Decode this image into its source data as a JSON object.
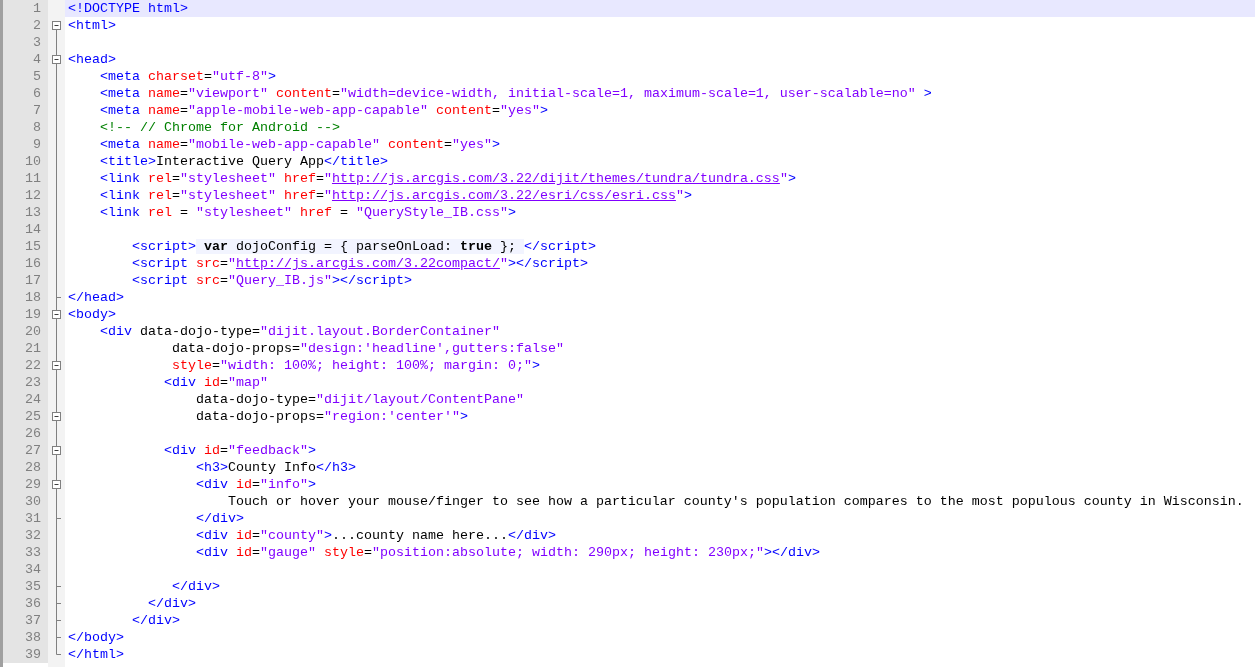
{
  "editor": {
    "lines": [
      {
        "number": "1",
        "current": true,
        "fold_start": false,
        "fold_end": false,
        "tokens": [
          {
            "kind": "tag",
            "text": "<!DOCTYPE html>"
          }
        ]
      },
      {
        "number": "2",
        "current": false,
        "fold_start": true,
        "fold_end": false,
        "tokens": [
          {
            "kind": "tag",
            "text": "<html>"
          }
        ]
      },
      {
        "number": "3",
        "current": false,
        "fold_start": false,
        "fold_end": false
      },
      {
        "number": "4",
        "current": false,
        "fold_start": true,
        "fold_end": false,
        "tokens": [
          {
            "kind": "tag",
            "text": "<head>"
          }
        ]
      },
      {
        "number": "5",
        "current": false,
        "fold_start": false,
        "fold_end": false,
        "tokens": [
          {
            "kind": "tag",
            "text": "    <meta "
          },
          {
            "kind": "attr",
            "text": "charset"
          },
          {
            "kind": "plain",
            "text": "="
          },
          {
            "kind": "value",
            "text": "\"utf-8\""
          },
          {
            "kind": "tag",
            "text": ">"
          }
        ]
      },
      {
        "number": "6",
        "current": false,
        "fold_start": false,
        "fold_end": false,
        "tokens": [
          {
            "kind": "tag",
            "text": "    <meta "
          },
          {
            "kind": "attr",
            "text": "name"
          },
          {
            "kind": "plain",
            "text": "="
          },
          {
            "kind": "value",
            "text": "\"viewport\" "
          },
          {
            "kind": "attr",
            "text": "content"
          },
          {
            "kind": "plain",
            "text": "="
          },
          {
            "kind": "value",
            "text": "\"width=device-width, initial-scale=1, maximum-scale=1, user-scalable=no\" "
          },
          {
            "kind": "tag",
            "text": ">"
          }
        ]
      },
      {
        "number": "7",
        "current": false,
        "fold_start": false,
        "fold_end": false,
        "tokens": [
          {
            "kind": "tag",
            "text": "    <meta "
          },
          {
            "kind": "attr",
            "text": "name"
          },
          {
            "kind": "plain",
            "text": "="
          },
          {
            "kind": "value",
            "text": "\"apple-mobile-web-app-capable\" "
          },
          {
            "kind": "attr",
            "text": "content"
          },
          {
            "kind": "plain",
            "text": "="
          },
          {
            "kind": "value",
            "text": "\"yes\""
          },
          {
            "kind": "tag",
            "text": ">"
          }
        ]
      },
      {
        "number": "8",
        "current": false,
        "fold_start": false,
        "fold_end": false,
        "tokens": [
          {
            "kind": "comment",
            "text": "    <!-- // Chrome for Android -->"
          }
        ]
      },
      {
        "number": "9",
        "current": false,
        "fold_start": false,
        "fold_end": false,
        "tokens": [
          {
            "kind": "tag",
            "text": "    <meta "
          },
          {
            "kind": "attr",
            "text": "name"
          },
          {
            "kind": "plain",
            "text": "="
          },
          {
            "kind": "value",
            "text": "\"mobile-web-app-capable\" "
          },
          {
            "kind": "attr",
            "text": "content"
          },
          {
            "kind": "plain",
            "text": "="
          },
          {
            "kind": "value",
            "text": "\"yes\""
          },
          {
            "kind": "tag",
            "text": ">"
          }
        ]
      },
      {
        "number": "10",
        "current": false,
        "fold_start": false,
        "fold_end": false,
        "tokens": [
          {
            "kind": "tag",
            "text": "    <title>"
          },
          {
            "kind": "text",
            "text": "Interactive Query App"
          },
          {
            "kind": "tag",
            "text": "</title>"
          }
        ]
      },
      {
        "number": "11",
        "current": false,
        "fold_start": false,
        "fold_end": false,
        "tokens": [
          {
            "kind": "tag",
            "text": "    <link "
          },
          {
            "kind": "attr",
            "text": "rel"
          },
          {
            "kind": "plain",
            "text": "="
          },
          {
            "kind": "value",
            "text": "\"stylesheet\" "
          },
          {
            "kind": "attr",
            "text": "href"
          },
          {
            "kind": "plain",
            "text": "="
          },
          {
            "kind": "value",
            "text": "\""
          },
          {
            "kind": "link",
            "text": "http://js.arcgis.com/3.22/dijit/themes/tundra/tundra.css"
          },
          {
            "kind": "value",
            "text": "\""
          },
          {
            "kind": "tag",
            "text": ">"
          }
        ]
      },
      {
        "number": "12",
        "current": false,
        "fold_start": false,
        "fold_end": false,
        "tokens": [
          {
            "kind": "tag",
            "text": "    <link "
          },
          {
            "kind": "attr",
            "text": "rel"
          },
          {
            "kind": "plain",
            "text": "="
          },
          {
            "kind": "value",
            "text": "\"stylesheet\" "
          },
          {
            "kind": "attr",
            "text": "href"
          },
          {
            "kind": "plain",
            "text": "="
          },
          {
            "kind": "value",
            "text": "\""
          },
          {
            "kind": "link",
            "text": "http://js.arcgis.com/3.22/esri/css/esri.css"
          },
          {
            "kind": "value",
            "text": "\""
          },
          {
            "kind": "tag",
            "text": ">"
          }
        ]
      },
      {
        "number": "13",
        "current": false,
        "fold_start": false,
        "fold_end": false,
        "tokens": [
          {
            "kind": "tag",
            "text": "    <link "
          },
          {
            "kind": "attr",
            "text": "rel"
          },
          {
            "kind": "plain",
            "text": " = "
          },
          {
            "kind": "value",
            "text": "\"stylesheet\" "
          },
          {
            "kind": "attr",
            "text": "href"
          },
          {
            "kind": "plain",
            "text": " = "
          },
          {
            "kind": "value",
            "text": "\"QueryStyle_IB.css\""
          },
          {
            "kind": "tag",
            "text": ">"
          }
        ]
      },
      {
        "number": "14",
        "current": false,
        "fold_start": false,
        "fold_end": false
      },
      {
        "number": "15",
        "current": false,
        "fold_start": false,
        "fold_end": false,
        "tokens": [
          {
            "kind": "tag",
            "text": "        <script>"
          },
          {
            "kind": "keyword",
            "text": " var"
          },
          {
            "kind": "script",
            "text": " dojoConfig = { parseOnLoad: "
          },
          {
            "kind": "keyword",
            "text": "true"
          },
          {
            "kind": "script",
            "text": " }; "
          },
          {
            "kind": "tag",
            "text": "</script>"
          }
        ]
      },
      {
        "number": "16",
        "current": false,
        "fold_start": false,
        "fold_end": false,
        "tokens": [
          {
            "kind": "tag",
            "text": "        <script "
          },
          {
            "kind": "attr",
            "text": "src"
          },
          {
            "kind": "plain",
            "text": "="
          },
          {
            "kind": "value",
            "text": "\""
          },
          {
            "kind": "link",
            "text": "http://js.arcgis.com/3.22compact/"
          },
          {
            "kind": "value",
            "text": "\""
          },
          {
            "kind": "tag",
            "text": "></script>"
          }
        ]
      },
      {
        "number": "17",
        "current": false,
        "fold_start": false,
        "fold_end": false,
        "tokens": [
          {
            "kind": "tag",
            "text": "        <script "
          },
          {
            "kind": "attr",
            "text": "src"
          },
          {
            "kind": "plain",
            "text": "="
          },
          {
            "kind": "value",
            "text": "\"Query_IB.js\""
          },
          {
            "kind": "tag",
            "text": "></script>"
          }
        ]
      },
      {
        "number": "18",
        "current": false,
        "fold_start": false,
        "fold_end": true,
        "tokens": [
          {
            "kind": "tag",
            "text": "</head>"
          }
        ]
      },
      {
        "number": "19",
        "current": false,
        "fold_start": true,
        "fold_end": false,
        "tokens": [
          {
            "kind": "tag",
            "text": "<body>"
          }
        ]
      },
      {
        "number": "20",
        "current": false,
        "fold_start": false,
        "fold_end": false,
        "tokens": [
          {
            "kind": "tag",
            "text": "    <div "
          },
          {
            "kind": "plain",
            "text": "data-dojo-type="
          },
          {
            "kind": "value",
            "text": "\"dijit.layout.BorderContainer\""
          }
        ]
      },
      {
        "number": "21",
        "current": false,
        "fold_start": false,
        "fold_end": false,
        "tokens": [
          {
            "kind": "plain",
            "text": "             data-dojo-props="
          },
          {
            "kind": "value",
            "text": "\"design:'headline',gutters:false\""
          }
        ]
      },
      {
        "number": "22",
        "current": false,
        "fold_start": true,
        "fold_end": false,
        "tokens": [
          {
            "kind": "attr",
            "text": "             style"
          },
          {
            "kind": "plain",
            "text": "="
          },
          {
            "kind": "value",
            "text": "\"width: 100%; height: 100%; margin: 0;\""
          },
          {
            "kind": "tag",
            "text": ">"
          }
        ]
      },
      {
        "number": "23",
        "current": false,
        "fold_start": false,
        "fold_end": false,
        "tokens": [
          {
            "kind": "tag",
            "text": "            <div "
          },
          {
            "kind": "attr",
            "text": "id"
          },
          {
            "kind": "plain",
            "text": "="
          },
          {
            "kind": "value",
            "text": "\"map\""
          }
        ]
      },
      {
        "number": "24",
        "current": false,
        "fold_start": false,
        "fold_end": false,
        "tokens": [
          {
            "kind": "plain",
            "text": "                data-dojo-type="
          },
          {
            "kind": "value",
            "text": "\"dijit/layout/ContentPane\""
          }
        ]
      },
      {
        "number": "25",
        "current": false,
        "fold_start": true,
        "fold_end": false,
        "tokens": [
          {
            "kind": "plain",
            "text": "                data-dojo-props="
          },
          {
            "kind": "value",
            "text": "\"region:'center'\""
          },
          {
            "kind": "tag",
            "text": ">"
          }
        ]
      },
      {
        "number": "26",
        "current": false,
        "fold_start": false,
        "fold_end": false
      },
      {
        "number": "27",
        "current": false,
        "fold_start": true,
        "fold_end": false,
        "tokens": [
          {
            "kind": "tag",
            "text": "            <div "
          },
          {
            "kind": "attr",
            "text": "id"
          },
          {
            "kind": "plain",
            "text": "="
          },
          {
            "kind": "value",
            "text": "\"feedback\""
          },
          {
            "kind": "tag",
            "text": ">"
          }
        ]
      },
      {
        "number": "28",
        "current": false,
        "fold_start": false,
        "fold_end": false,
        "tokens": [
          {
            "kind": "tag",
            "text": "                <h3>"
          },
          {
            "kind": "text",
            "text": "County Info"
          },
          {
            "kind": "tag",
            "text": "</h3>"
          }
        ]
      },
      {
        "number": "29",
        "current": false,
        "fold_start": true,
        "fold_end": false,
        "tokens": [
          {
            "kind": "tag",
            "text": "                <div "
          },
          {
            "kind": "attr",
            "text": "id"
          },
          {
            "kind": "plain",
            "text": "="
          },
          {
            "kind": "value",
            "text": "\"info\""
          },
          {
            "kind": "tag",
            "text": ">"
          }
        ]
      },
      {
        "number": "30",
        "current": false,
        "fold_start": false,
        "fold_end": false,
        "tokens": [
          {
            "kind": "text",
            "text": "                    Touch or hover your mouse/finger to see how a particular county's population compares to the most populous county in Wisconsin."
          }
        ]
      },
      {
        "number": "31",
        "current": false,
        "fold_start": false,
        "fold_end": true,
        "tokens": [
          {
            "kind": "tag",
            "text": "                </div>"
          }
        ]
      },
      {
        "number": "32",
        "current": false,
        "fold_start": false,
        "fold_end": false,
        "tokens": [
          {
            "kind": "tag",
            "text": "                <div "
          },
          {
            "kind": "attr",
            "text": "id"
          },
          {
            "kind": "plain",
            "text": "="
          },
          {
            "kind": "value",
            "text": "\"county\""
          },
          {
            "kind": "tag",
            "text": ">"
          },
          {
            "kind": "text",
            "text": "...county name here..."
          },
          {
            "kind": "tag",
            "text": "</div>"
          }
        ]
      },
      {
        "number": "33",
        "current": false,
        "fold_start": false,
        "fold_end": false,
        "tokens": [
          {
            "kind": "tag",
            "text": "                <div "
          },
          {
            "kind": "attr",
            "text": "id"
          },
          {
            "kind": "plain",
            "text": "="
          },
          {
            "kind": "value",
            "text": "\"gauge\" "
          },
          {
            "kind": "attr",
            "text": "style"
          },
          {
            "kind": "plain",
            "text": "="
          },
          {
            "kind": "value",
            "text": "\"position:absolute; width: 290px; height: 230px;\""
          },
          {
            "kind": "tag",
            "text": "></div>"
          }
        ]
      },
      {
        "number": "34",
        "current": false,
        "fold_start": false,
        "fold_end": false
      },
      {
        "number": "35",
        "current": false,
        "fold_start": false,
        "fold_end": true,
        "tokens": [
          {
            "kind": "tag",
            "text": "             </div>"
          }
        ]
      },
      {
        "number": "36",
        "current": false,
        "fold_start": false,
        "fold_end": true,
        "tokens": [
          {
            "kind": "tag",
            "text": "          </div>"
          }
        ]
      },
      {
        "number": "37",
        "current": false,
        "fold_start": false,
        "fold_end": true,
        "tokens": [
          {
            "kind": "tag",
            "text": "        </div>"
          }
        ]
      },
      {
        "number": "38",
        "current": false,
        "fold_start": false,
        "fold_end": true,
        "tokens": [
          {
            "kind": "tag",
            "text": "</body>"
          }
        ]
      },
      {
        "number": "39",
        "current": false,
        "fold_start": false,
        "fold_end": true,
        "tokens": [
          {
            "kind": "tag",
            "text": "</html>"
          }
        ]
      }
    ]
  }
}
